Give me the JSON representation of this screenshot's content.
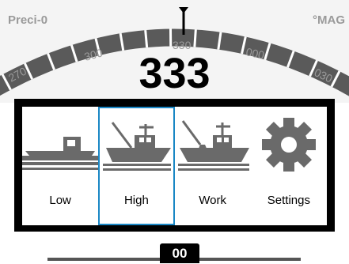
{
  "header": {
    "left_label": "Preci-0",
    "right_label": "°MAG",
    "heading": "333"
  },
  "compass": {
    "ticks": [
      "270",
      "300",
      "330",
      "000",
      "030"
    ]
  },
  "modes": [
    {
      "label": "Low",
      "icon": "boat-small-icon",
      "selected": false
    },
    {
      "label": "High",
      "icon": "boat-trawler-icon",
      "selected": true
    },
    {
      "label": "Work",
      "icon": "boat-work-icon",
      "selected": false
    },
    {
      "label": "Settings",
      "icon": "gear-icon",
      "selected": false
    }
  ],
  "rudder": {
    "value": "00"
  },
  "colors": {
    "selected": "#1a87c5",
    "icon": "#6a6a6a"
  }
}
